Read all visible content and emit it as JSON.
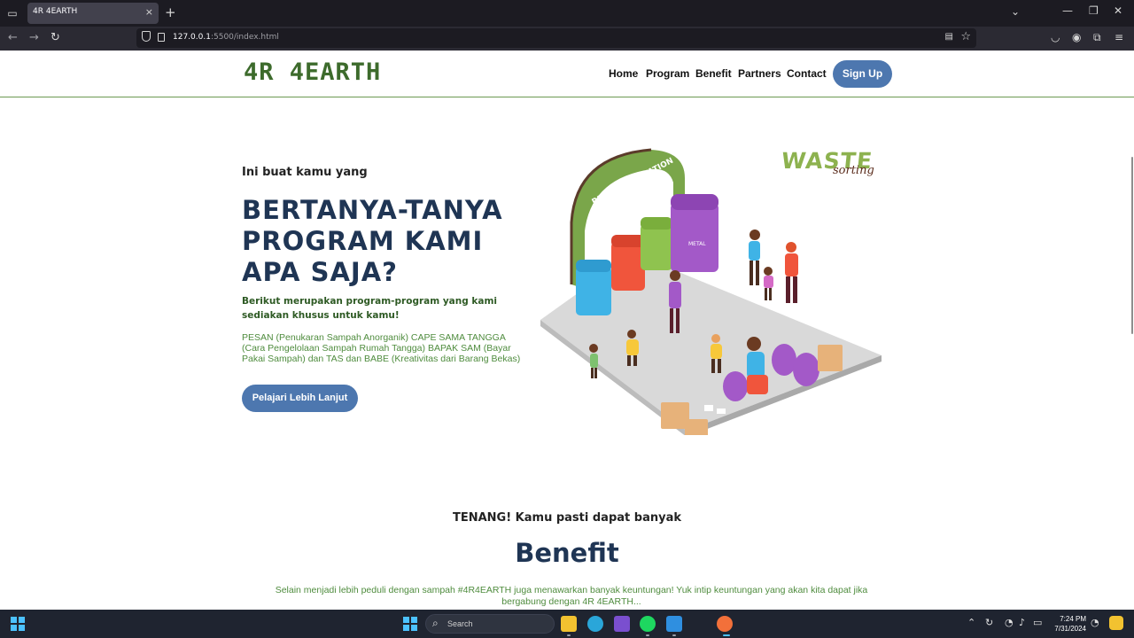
{
  "browser": {
    "tab_title": "4R 4EARTH",
    "tab_close": "×",
    "new_tab": "+",
    "url_host": "127.0.0.1",
    "url_rest": ":5500/index.html",
    "icons": {
      "tab_list": "tabs-icon",
      "back": "back-arrow-icon",
      "forward": "forward-arrow-icon",
      "reload": "reload-icon",
      "shield": "tracking-shield-icon",
      "page": "page-info-icon",
      "reader": "reader-view-icon",
      "bookmark": "bookmark-star-icon",
      "pocket": "pocket-icon",
      "account": "account-icon",
      "extensions": "extensions-icon",
      "menu": "hamburger-menu-icon"
    }
  },
  "site": {
    "logo": "4R 4EARTH",
    "nav": [
      "Home",
      "Program",
      "Benefit",
      "Partners",
      "Contact"
    ],
    "signup": "Sign Up",
    "colors": {
      "brand_green": "#3d6b2c",
      "accent_blue": "#4d77af",
      "heading_navy": "#1f3554",
      "text_green": "#4f8c3e"
    }
  },
  "hero": {
    "intro": "Ini buat kamu yang",
    "title_lines": [
      "BERTANYA-TANYA",
      "PROGRAM KAMI",
      "APA SAJA?"
    ],
    "lead": "Berikut merupakan program-program yang kami sediakan khusus untuk kamu!",
    "programs": "PESAN (Penukaran Sampah Anorganik) CAPE SAMA TANGGA (Cara Pengelolaan Sampah Rumah Tangga) BAPAK SAM (Bayar Pakai Sampah) dan TAS dan BABE (Kreativitas dari Barang Bekas)",
    "cta": "Pelajari Lebih Lanjut",
    "illustration": {
      "waste": "WASTE",
      "sorting": "sorting",
      "station": "RECYCLING STATION",
      "bin_metal": "METAL"
    }
  },
  "benefit": {
    "kicker": "TENANG! Kamu pasti dapat banyak",
    "title": "Benefit",
    "text": "Selain menjadi lebih peduli dengan sampah #4R4EARTH juga menawarkan banyak keuntungan! Yuk intip keuntungan yang akan kita dapat jika bergabung dengan 4R 4EARTH..."
  },
  "taskbar": {
    "search": "Search",
    "time": "7:24 PM",
    "date": "7/31/2024",
    "apps": [
      "start-icon",
      "file-explorer-icon",
      "edge-icon",
      "visual-studio-icon",
      "spotify-icon",
      "vscode-icon",
      "firefox-icon"
    ]
  }
}
